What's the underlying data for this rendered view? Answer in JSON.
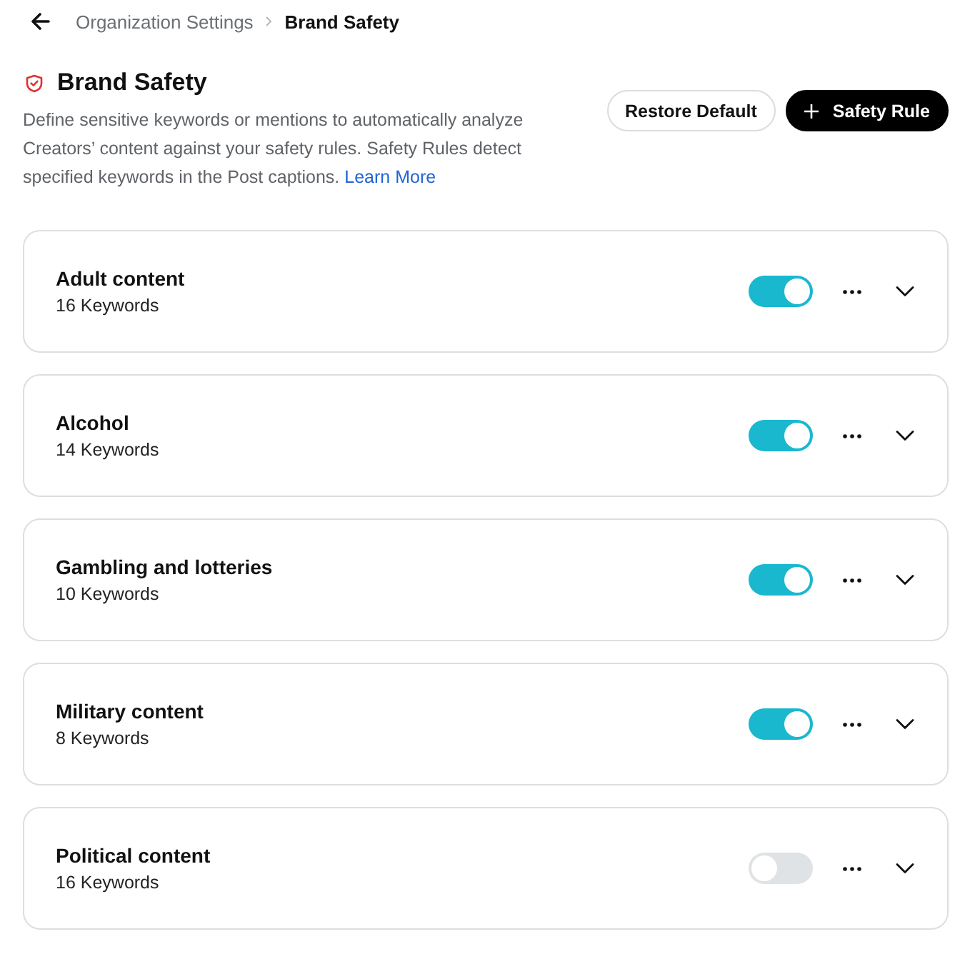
{
  "breadcrumb": {
    "items": [
      {
        "label": "Organization Settings",
        "current": false
      },
      {
        "label": "Brand Safety",
        "current": true
      }
    ]
  },
  "header": {
    "title": "Brand Safety",
    "description": "Define sensitive keywords or mentions to automatically analyze Creators’ content against your safety rules. Safety Rules detect specified keywords in the Post captions.",
    "link": "Learn More"
  },
  "actions": [
    {
      "kind": "secondary",
      "label": "Restore Default"
    },
    {
      "kind": "primary",
      "label": "Safety Rule"
    }
  ],
  "rules": [
    {
      "name": "Adult content",
      "count": "16 Keywords",
      "on": true
    },
    {
      "name": "Alcohol",
      "count": "14 Keywords",
      "on": true
    },
    {
      "name": "Gambling and lotteries",
      "count": "10 Keywords",
      "on": true
    },
    {
      "name": "Military content",
      "count": "8 Keywords",
      "on": true
    },
    {
      "name": "Political content",
      "count": "16 Keywords",
      "on": false
    }
  ]
}
